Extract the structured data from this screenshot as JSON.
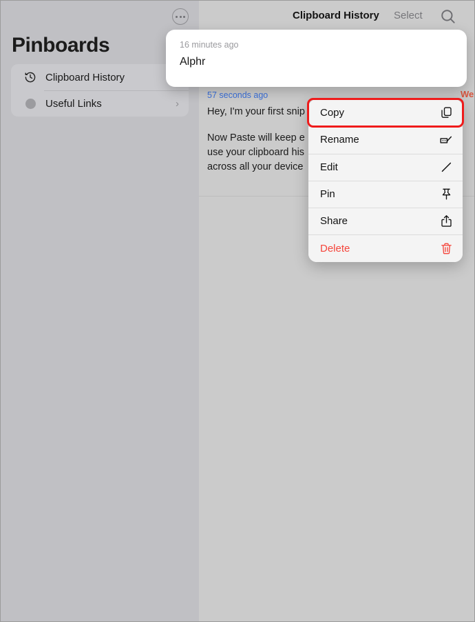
{
  "sidebar": {
    "more_button": "more-options",
    "title": "Pinboards",
    "items": [
      {
        "label": "Clipboard History",
        "icon": "clock-arrow-icon",
        "chevron": ""
      },
      {
        "label": "Useful Links",
        "icon": "circle-dot-icon",
        "chevron": "›"
      }
    ]
  },
  "header": {
    "title": "Clipboard History",
    "select_label": "Select",
    "search_icon": "search-icon"
  },
  "snippet": {
    "timestamp": "57 seconds ago",
    "title": "Welcome",
    "line1": "Hey, I'm your first snip",
    "line2": "Now Paste will keep e",
    "line3": "use your clipboard his",
    "line4": "across all your device"
  },
  "popup_card": {
    "timestamp": "16 minutes ago",
    "text": "Alphr"
  },
  "context_menu": {
    "items": [
      {
        "label": "Copy",
        "icon": "copy-icon",
        "danger": false,
        "highlighted": true
      },
      {
        "label": "Rename",
        "icon": "rename-icon",
        "danger": false,
        "highlighted": false
      },
      {
        "label": "Edit",
        "icon": "pencil-icon",
        "danger": false,
        "highlighted": false
      },
      {
        "label": "Pin",
        "icon": "pin-icon",
        "danger": false,
        "highlighted": false
      },
      {
        "label": "Share",
        "icon": "share-icon",
        "danger": false,
        "highlighted": false
      },
      {
        "label": "Delete",
        "icon": "trash-icon",
        "danger": true,
        "highlighted": false
      }
    ]
  },
  "colors": {
    "background": "#cbcbcb",
    "sidebar": "#c0c0c4",
    "accent_blue": "#3a6fd8",
    "danger_red": "#f5453b",
    "highlight_red": "#ef1b1b",
    "title_orange": "#d9563f"
  }
}
